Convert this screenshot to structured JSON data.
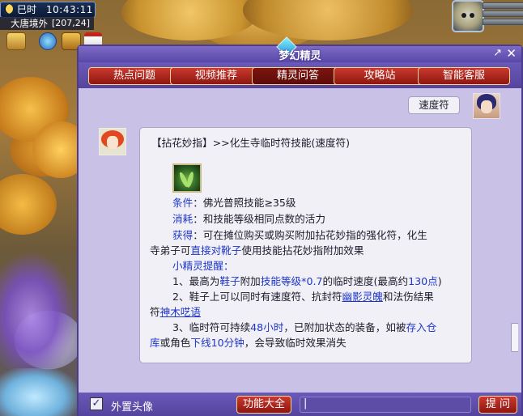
{
  "hud": {
    "period": "巳时",
    "clock": "10:43:11",
    "map_name": "大唐境外",
    "coords": "[207,24]"
  },
  "dialog": {
    "title": "梦幻精灵",
    "tabs": [
      {
        "label": "热点问题"
      },
      {
        "label": "视频推荐"
      },
      {
        "label": "精灵问答"
      },
      {
        "label": "攻略站"
      },
      {
        "label": "智能客服"
      }
    ],
    "active_tab": "精灵问答"
  },
  "chat": {
    "user_message": "速度符",
    "answer": {
      "heading": "【拈花妙指】>>化生寺临时符技能(速度符)",
      "cond_label": "条件",
      "cond_value": "：佛光普照技能≥35级",
      "cost_label": "消耗",
      "cost_value": "：和技能等级相同点数的活力",
      "get_label": "获得",
      "get_value_1": "：可在摊位购买或购买附加拈花妙指的强化符，化生",
      "get_value_2a": "寺弟子可",
      "get_value_2b": "直接对靴子",
      "get_value_2c": "使用技能拈花妙指附加效果",
      "tips_label": "小精灵提醒：",
      "tip1_a": "1、最高为",
      "tip1_b": "鞋子",
      "tip1_c": "附加",
      "tip1_d": "技能等级*0.7",
      "tip1_e": "的临时速度(最高约",
      "tip1_f": "130点",
      "tip1_g": ")",
      "tip2_a": "2、鞋子上可以同时有速度符、抗封符",
      "tip2_b": "幽影灵魄",
      "tip2_c": "和法伤结果",
      "tip2_d": "符",
      "tip2_e": "神木呓语",
      "tip3_a": "3、临时符可持续",
      "tip3_b": "48小时",
      "tip3_c": "，已附加状态的装备，如被",
      "tip3_d": "存入仓",
      "tip3_e": "库",
      "tip3_f": "或角色",
      "tip3_g": "下线10分钟",
      "tip3_h": "，会导致临时效果消失"
    }
  },
  "bottom": {
    "checkbox_mark": "✓",
    "checkbox_label": "外置头像",
    "features_button": "功能大全",
    "input_value": "|",
    "ask_button": "提 问"
  },
  "colors": {
    "link_blue": "#1d36c9",
    "button_red": "#b12a20",
    "panel_purple": "#c9c2e6"
  }
}
